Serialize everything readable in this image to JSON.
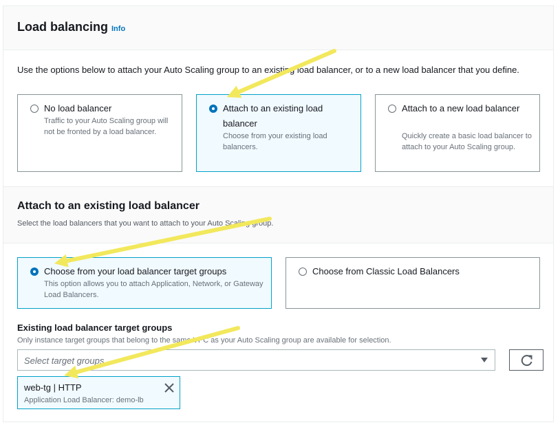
{
  "load_balancing": {
    "title": "Load balancing",
    "info_label": "Info",
    "description": "Use the options below to attach your Auto Scaling group to an existing load balancer, or to a new load balancer that you define.",
    "options": [
      {
        "title": "No load balancer",
        "description": "Traffic to your Auto Scaling group will not be fronted by a load balancer.",
        "selected": false
      },
      {
        "title": "Attach to an existing load balancer",
        "description": "Choose from your existing load balancers.",
        "selected": true
      },
      {
        "title": "Attach to a new load balancer",
        "description": "Quickly create a basic load balancer to attach to your Auto Scaling group.",
        "selected": false
      }
    ]
  },
  "attach_existing": {
    "title": "Attach to an existing load balancer",
    "description": "Select the load balancers that you want to attach to your Auto Scaling group.",
    "options": [
      {
        "title": "Choose from your load balancer target groups",
        "description": "This option allows you to attach Application, Network, or Gateway Load Balancers.",
        "selected": true
      },
      {
        "title": "Choose from Classic Load Balancers",
        "description": "",
        "selected": false
      }
    ]
  },
  "target_groups": {
    "label": "Existing load balancer target groups",
    "description": "Only instance target groups that belong to the same VPC as your Auto Scaling group are available for selection.",
    "placeholder": "Select target groups",
    "selected": {
      "name": "web-tg | HTTP",
      "detail": "Application Load Balancer: demo-lb"
    }
  },
  "icons": {
    "refresh": "refresh-icon",
    "close": "close-icon",
    "dropdown": "caret-down-icon",
    "annotation": "arrow-annotation"
  },
  "colors": {
    "accent": "#0073bb",
    "selected_bg": "#f1faff",
    "selected_border": "#00a1c9",
    "annotation_arrow": "#f2e85c"
  }
}
